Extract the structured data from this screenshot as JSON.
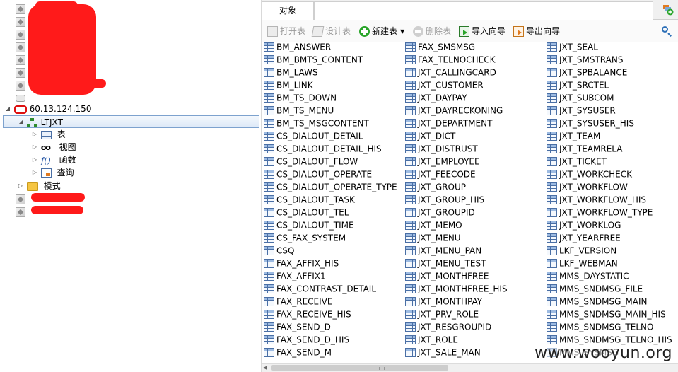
{
  "tree": {
    "connection_ip": "60.13.124.150",
    "schema_name": "LTJXT",
    "children": [
      {
        "label": "表",
        "icon": "table-icon"
      },
      {
        "label": "视图",
        "icon": "view-icon"
      },
      {
        "label": "函数",
        "icon": "function-icon"
      },
      {
        "label": "查询",
        "icon": "query-icon"
      }
    ],
    "schemas_folder_label": "模式"
  },
  "tabs": {
    "objects_label": "对象"
  },
  "toolbar": {
    "open_table": "打开表",
    "design_table": "设计表",
    "new_table": "新建表",
    "delete_table": "删除表",
    "import_wizard": "导入向导",
    "export_wizard": "导出向导"
  },
  "objects": {
    "col1": [
      "BM_ANSWER",
      "BM_BMTS_CONTENT",
      "BM_LAWS",
      "BM_LINK",
      "BM_TS_DOWN",
      "BM_TS_MENU",
      "BM_TS_MSGCONTENT",
      "CS_DIALOUT_DETAIL",
      "CS_DIALOUT_DETAIL_HIS",
      "CS_DIALOUT_FLOW",
      "CS_DIALOUT_OPERATE",
      "CS_DIALOUT_OPERATE_TYPE",
      "CS_DIALOUT_TASK",
      "CS_DIALOUT_TEL",
      "CS_DIALOUT_TIME",
      "CS_FAX_SYSTEM",
      "CSQ",
      "FAX_AFFIX_HIS",
      "FAX_AFFIX1",
      "FAX_CONTRAST_DETAIL",
      "FAX_RECEIVE",
      "FAX_RECEIVE_HIS",
      "FAX_SEND_D",
      "FAX_SEND_D_HIS",
      "FAX_SEND_M"
    ],
    "col2": [
      "FAX_SMSMSG",
      "FAX_TELNOCHECK",
      "JXT_CALLINGCARD",
      "JXT_CUSTOMER",
      "JXT_DAYPAY",
      "JXT_DAYRECKONING",
      "JXT_DEPARTMENT",
      "JXT_DICT",
      "JXT_DISTRUST",
      "JXT_EMPLOYEE",
      "JXT_FEECODE",
      "JXT_GROUP",
      "JXT_GROUP_HIS",
      "JXT_GROUPID",
      "JXT_MEMO",
      "JXT_MENU",
      "JXT_MENU_PAN",
      "JXT_MENU_TEST",
      "JXT_MONTHFREE",
      "JXT_MONTHFREE_HIS",
      "JXT_MONTHPAY",
      "JXT_PRV_ROLE",
      "JXT_RESGROUPID",
      "JXT_ROLE",
      "JXT_SALE_MAN"
    ],
    "col3": [
      "JXT_SEAL",
      "JXT_SMSTRANS",
      "JXT_SPBALANCE",
      "JXT_SRCTEL",
      "JXT_SUBCOM",
      "JXT_SYSUSER",
      "JXT_SYSUSER_HIS",
      "JXT_TEAM",
      "JXT_TEAMRELA",
      "JXT_TICKET",
      "JXT_WORKCHECK",
      "JXT_WORKFLOW",
      "JXT_WORKFLOW_HIS",
      "JXT_WORKFLOW_TYPE",
      "JXT_WORKLOG",
      "JXT_YEARFREE",
      "LKF_VERSION",
      "LKF_WEBMAN",
      "MMS_DAYSTATIC",
      "MMS_SNDMSG_FILE",
      "MMS_SNDMSG_MAIN",
      "MMS_SNDMSG_MAIN_HIS",
      "MMS_SNDMSG_TELNO",
      "MMS_SNDMSG_TELNO_HIS",
      "MMS_SYSMSG"
    ]
  },
  "watermark": "www.wooyun.org",
  "colors": {
    "redaction": "#ff1a1a",
    "oracle": "#dd1111",
    "accent_blue": "#4a6fa5"
  }
}
